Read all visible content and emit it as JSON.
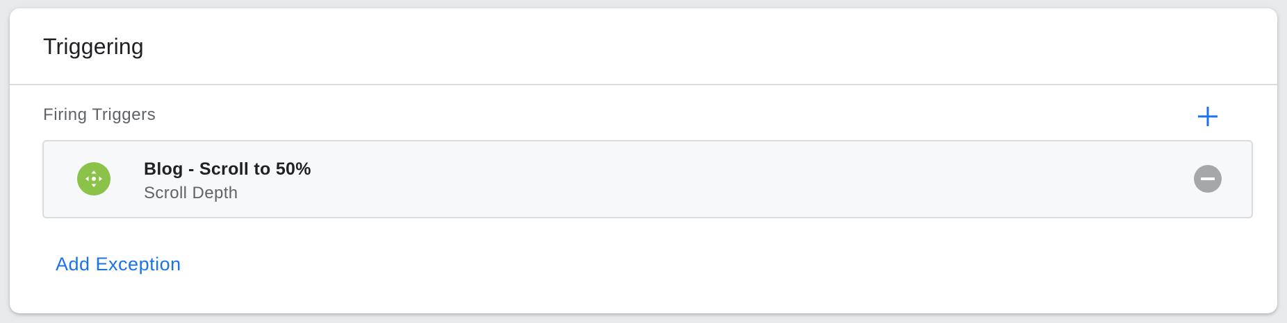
{
  "card": {
    "title": "Triggering"
  },
  "firing_triggers": {
    "label": "Firing Triggers",
    "add_icon": "plus-icon",
    "items": [
      {
        "name": "Blog - Scroll to 50%",
        "type": "Scroll Depth",
        "icon": "scroll-depth-icon",
        "icon_color": "#8bc34a",
        "remove_icon": "remove-circle-icon"
      }
    ]
  },
  "exceptions": {
    "add_label": "Add Exception"
  },
  "colors": {
    "accent": "#1a73e8",
    "text_primary": "#202124",
    "text_secondary": "#5f6368",
    "remove_button": "#a6a7a9"
  }
}
